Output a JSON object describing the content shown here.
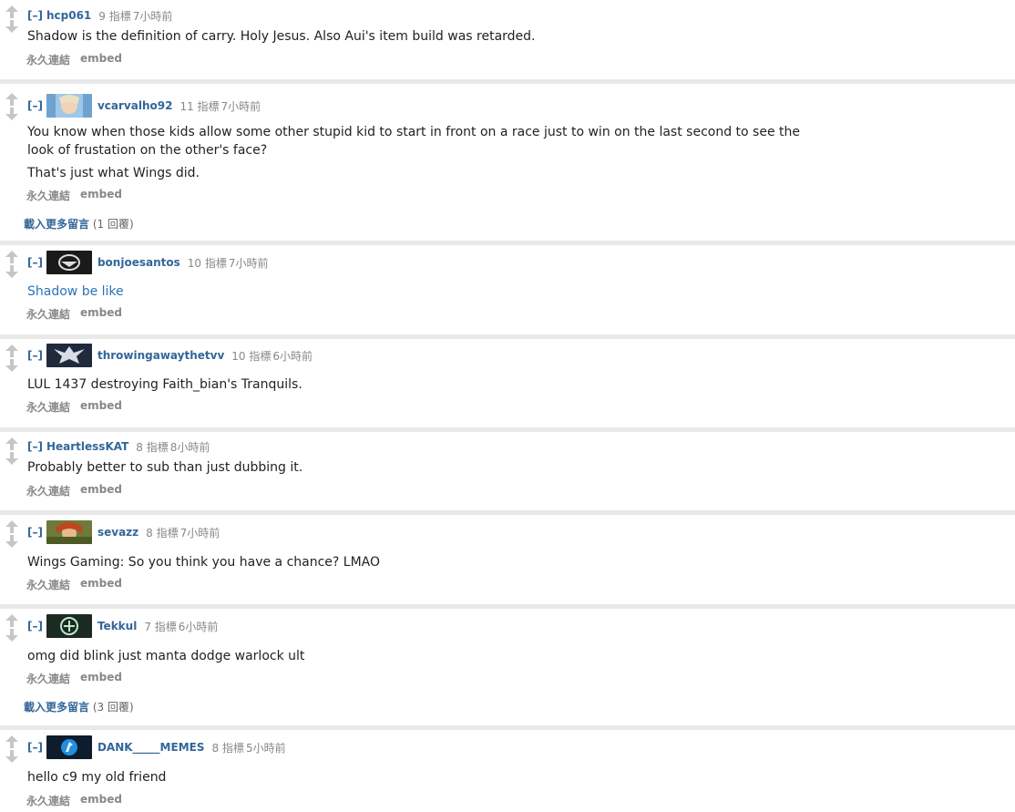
{
  "ui": {
    "toggle": "[–]",
    "permalink": "永久連結",
    "embed": "embed",
    "load_more": "載入更多留言"
  },
  "comments": [
    {
      "author": "hcp061",
      "score": "9 指標",
      "time": "7小時前",
      "avatar": "",
      "body": [
        "Shadow is the definition of carry. Holy Jesus. Also Aui's item build was retarded."
      ]
    },
    {
      "author": "vcarvalho92",
      "score": "11 指標",
      "time": "7小時前",
      "avatar": "crystal-maiden",
      "body": [
        "You know when those kids allow some other stupid kid to start in front on a race just to win on the last second to see the look of frustation on the other's face?",
        "That's just what Wings did."
      ],
      "more": "(1 回覆)"
    },
    {
      "author": "bonjoesantos",
      "score": "10 指標",
      "time": "7小時前",
      "avatar": "team-secret",
      "body": [
        "Shadow be like"
      ]
    },
    {
      "author": "throwingawaythetvv",
      "score": "10 指標",
      "time": "6小時前",
      "avatar": "eagle-crest",
      "body": [
        "LUL 1437 destroying Faith_bian's Tranquils."
      ]
    },
    {
      "author": "HeartlessKAT",
      "score": "8 指標",
      "time": "8小時前",
      "avatar": "",
      "body": [
        "Probably better to sub than just dubbing it."
      ]
    },
    {
      "author": "sevazz",
      "score": "8 指標",
      "time": "7小時前",
      "avatar": "windranger",
      "body": [
        "Wings Gaming: So you think you have a chance? LMAO"
      ]
    },
    {
      "author": "Tekkul",
      "score": "7 指標",
      "time": "6小時前",
      "avatar": "optic",
      "body": [
        "omg did blink just manta dodge warlock ult"
      ],
      "more": "(3 回覆)"
    },
    {
      "author": "DANK_____MEMES",
      "score": "8 指標",
      "time": "5小時前",
      "avatar": "blue-logo",
      "body": [
        "hello c9 my old friend"
      ]
    }
  ]
}
